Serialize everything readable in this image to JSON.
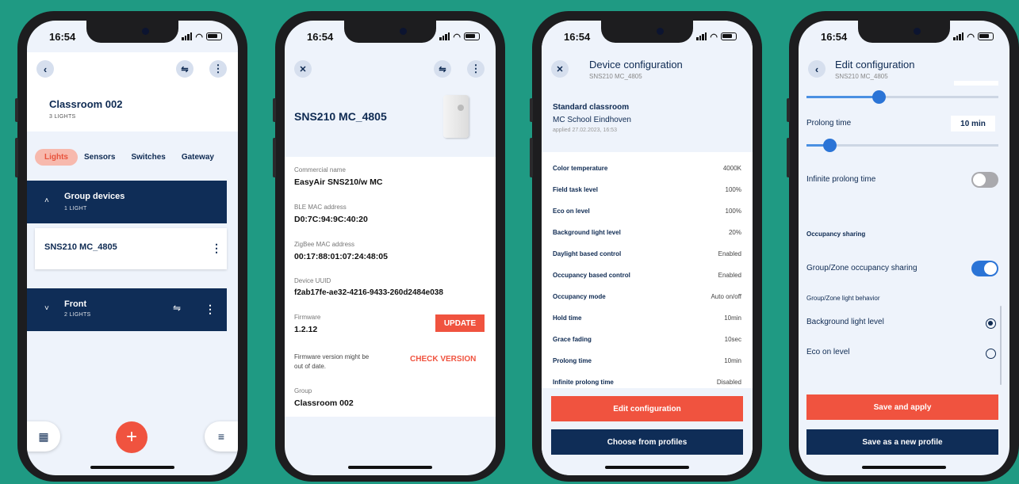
{
  "status_time": "16:54",
  "phone1": {
    "room_title": "Classroom 002",
    "room_sub": "3 LIGHTS",
    "tabs": [
      "Lights",
      "Sensors",
      "Switches",
      "Gateway"
    ],
    "group1": {
      "title": "Group devices",
      "sub": "1 LIGHT"
    },
    "device": "SNS210 MC_4805",
    "group2": {
      "title": "Front",
      "sub": "2 LIGHTS"
    }
  },
  "phone2": {
    "title": "SNS210 MC_4805",
    "fields": [
      {
        "label": "Commercial name",
        "value": "EasyAir SNS210/w MC"
      },
      {
        "label": "BLE MAC address",
        "value": "D0:7C:94:9C:40:20"
      },
      {
        "label": "ZigBee MAC address",
        "value": "00:17:88:01:07:24:48:05"
      },
      {
        "label": "Device UUID",
        "value": "f2ab17fe-ae32-4216-9433-260d2484e038"
      },
      {
        "label": "Firmware",
        "value": "1.2.12"
      }
    ],
    "update_label": "UPDATE",
    "fw_note_line1": "Firmware version might be",
    "fw_note_line2": "out of date.",
    "check_label": "CHECK VERSION",
    "group_label": "Group",
    "group_value": "Classroom 002"
  },
  "phone3": {
    "title": "Device configuration",
    "subtitle": "SNS210 MC_4805",
    "profile_name": "Standard classroom",
    "profile_org": "MC School Eindhoven",
    "profile_applied": "applied 27.02.2023, 16:53",
    "rows": [
      {
        "k": "Color temperature",
        "v": "4000K"
      },
      {
        "k": "Field task level",
        "v": "100%"
      },
      {
        "k": "Eco on level",
        "v": "100%"
      },
      {
        "k": "Background light level",
        "v": "20%"
      },
      {
        "k": "Daylight based control",
        "v": "Enabled"
      },
      {
        "k": "Occupancy based control",
        "v": "Enabled"
      },
      {
        "k": "Occupancy mode",
        "v": "Auto on/off"
      },
      {
        "k": "Hold time",
        "v": "10min"
      },
      {
        "k": "Grace fading",
        "v": "10sec"
      },
      {
        "k": "Prolong time",
        "v": "10min"
      },
      {
        "k": "Infinite prolong time",
        "v": "Disabled"
      }
    ],
    "edit_label": "Edit configuration",
    "choose_label": "Choose from profiles"
  },
  "phone4": {
    "title": "Edit configuration",
    "subtitle": "SNS210 MC_4805",
    "prolong_label": "Prolong time",
    "prolong_value": "10 min",
    "top_slider_level": 0.38,
    "prolong_slider_level": 0.12,
    "infinite_label": "Infinite prolong time",
    "infinite_on": false,
    "occ_section": "Occupancy sharing",
    "group_zone_label": "Group/Zone occupancy sharing",
    "group_zone_on": true,
    "behavior_label": "Group/Zone light behavior",
    "options": [
      {
        "label": "Background light level",
        "selected": true
      },
      {
        "label": "Eco on level",
        "selected": false
      }
    ],
    "save_apply": "Save and apply",
    "save_profile": "Save as a new profile"
  },
  "colors": {
    "background": "#1f9a83",
    "navy": "#0f2d57",
    "accent": "#f0533f",
    "toggle_on": "#2b74d6"
  }
}
